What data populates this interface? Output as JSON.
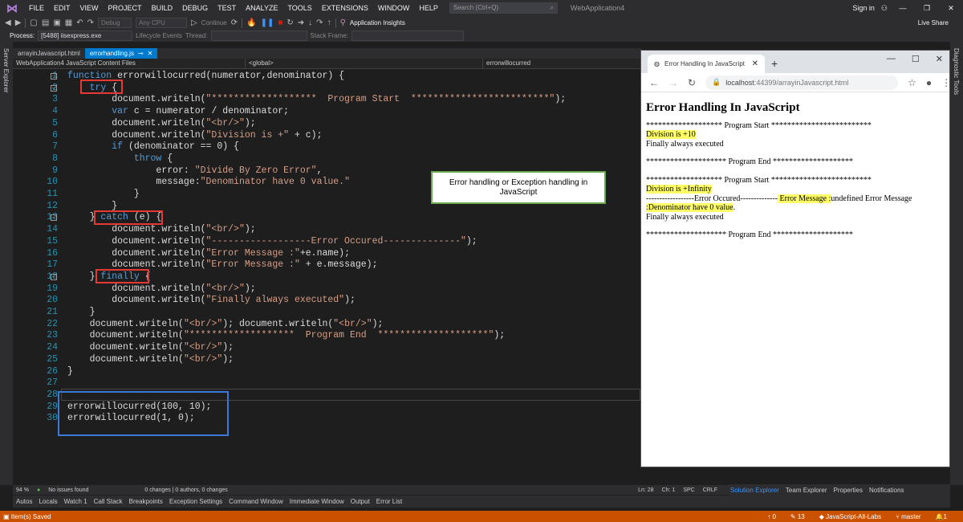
{
  "menubar": {
    "items": [
      "FILE",
      "EDIT",
      "VIEW",
      "PROJECT",
      "BUILD",
      "DEBUG",
      "TEST",
      "ANALYZE",
      "TOOLS",
      "EXTENSIONS",
      "WINDOW",
      "HELP"
    ],
    "search_placeholder": "Search (Ctrl+Q)",
    "solution": "WebApplication4",
    "signin": "Sign in",
    "liveshare": "Live Share"
  },
  "toolbar": {
    "config": "Debug",
    "platform": "Any CPU",
    "continue": "Continue",
    "insights": "Application Insights"
  },
  "procbar": {
    "process_label": "Process:",
    "process_value": "[5488] iisexpress.exe",
    "lifecycle": "Lifecycle Events",
    "thread": "Thread:",
    "stackframe": "Stack Frame:"
  },
  "sidebars": {
    "left": "Server Explorer",
    "right": "Diagnostic Tools"
  },
  "tabs": [
    "arrayinJavascript.html",
    "errorhandling.js"
  ],
  "navbar": {
    "project": "WebApplication4 JavaScript Content Files",
    "scope": "<global>",
    "member": "errorwillocurred"
  },
  "code": {
    "lines": [
      {
        "n": "1",
        "segs": [
          {
            "t": "function ",
            "c": "kw"
          },
          {
            "t": "errorwillocurred(numerator,denominator) {",
            "c": "ident"
          }
        ]
      },
      {
        "n": "2",
        "segs": [
          {
            "t": "    try ",
            "c": "kw"
          },
          {
            "t": "{",
            "c": "ident"
          }
        ]
      },
      {
        "n": "3",
        "segs": [
          {
            "t": "        document.writeln(",
            "c": "ident"
          },
          {
            "t": "\"*******************  Program Start  *************************\"",
            "c": "str"
          },
          {
            "t": ");",
            "c": "ident"
          }
        ]
      },
      {
        "n": "4",
        "segs": [
          {
            "t": "        ",
            "c": "ident"
          },
          {
            "t": "var ",
            "c": "kw"
          },
          {
            "t": "c = numerator / denominator;",
            "c": "ident"
          }
        ]
      },
      {
        "n": "5",
        "segs": [
          {
            "t": "        document.writeln(",
            "c": "ident"
          },
          {
            "t": "\"<br/>\"",
            "c": "str"
          },
          {
            "t": ");",
            "c": "ident"
          }
        ]
      },
      {
        "n": "6",
        "segs": [
          {
            "t": "        document.writeln(",
            "c": "ident"
          },
          {
            "t": "\"Division is +\"",
            "c": "str"
          },
          {
            "t": " + c);",
            "c": "ident"
          }
        ]
      },
      {
        "n": "7",
        "segs": [
          {
            "t": "        ",
            "c": "ident"
          },
          {
            "t": "if ",
            "c": "kw"
          },
          {
            "t": "(denominator == 0) {",
            "c": "ident"
          }
        ]
      },
      {
        "n": "8",
        "segs": [
          {
            "t": "            ",
            "c": "ident"
          },
          {
            "t": "throw ",
            "c": "kw"
          },
          {
            "t": "{",
            "c": "ident"
          }
        ]
      },
      {
        "n": "9",
        "segs": [
          {
            "t": "                error: ",
            "c": "ident"
          },
          {
            "t": "\"Divide By Zero Error\"",
            "c": "str"
          },
          {
            "t": ",",
            "c": "ident"
          }
        ]
      },
      {
        "n": "10",
        "segs": [
          {
            "t": "                message:",
            "c": "ident"
          },
          {
            "t": "\"Denominator have 0 value.\"",
            "c": "str"
          }
        ]
      },
      {
        "n": "11",
        "segs": [
          {
            "t": "            }",
            "c": "ident"
          }
        ]
      },
      {
        "n": "12",
        "segs": [
          {
            "t": "        }",
            "c": "ident"
          }
        ]
      },
      {
        "n": "13",
        "segs": [
          {
            "t": "    } ",
            "c": "ident"
          },
          {
            "t": "catch ",
            "c": "kw"
          },
          {
            "t": "(e) {",
            "c": "ident"
          }
        ]
      },
      {
        "n": "14",
        "segs": [
          {
            "t": "        document.writeln(",
            "c": "ident"
          },
          {
            "t": "\"<br/>\"",
            "c": "str"
          },
          {
            "t": ");",
            "c": "ident"
          }
        ]
      },
      {
        "n": "15",
        "segs": [
          {
            "t": "        document.writeln(",
            "c": "ident"
          },
          {
            "t": "\"------------------Error Occured--------------\"",
            "c": "str"
          },
          {
            "t": ");",
            "c": "ident"
          }
        ]
      },
      {
        "n": "16",
        "segs": [
          {
            "t": "        document.writeln(",
            "c": "ident"
          },
          {
            "t": "\"Error Message :\"",
            "c": "str"
          },
          {
            "t": "+e.name);",
            "c": "ident"
          }
        ]
      },
      {
        "n": "17",
        "segs": [
          {
            "t": "        document.writeln(",
            "c": "ident"
          },
          {
            "t": "\"Error Message :\"",
            "c": "str"
          },
          {
            "t": " + e.message);",
            "c": "ident"
          }
        ]
      },
      {
        "n": "18",
        "segs": [
          {
            "t": "    } ",
            "c": "ident"
          },
          {
            "t": "finally ",
            "c": "kw"
          },
          {
            "t": "{",
            "c": "ident"
          }
        ]
      },
      {
        "n": "19",
        "segs": [
          {
            "t": "        document.writeln(",
            "c": "ident"
          },
          {
            "t": "\"<br/>\"",
            "c": "str"
          },
          {
            "t": ");",
            "c": "ident"
          }
        ]
      },
      {
        "n": "20",
        "segs": [
          {
            "t": "        document.writeln(",
            "c": "ident"
          },
          {
            "t": "\"Finally always executed\"",
            "c": "str"
          },
          {
            "t": ");",
            "c": "ident"
          }
        ]
      },
      {
        "n": "21",
        "segs": [
          {
            "t": "    }",
            "c": "ident"
          }
        ]
      },
      {
        "n": "22",
        "segs": [
          {
            "t": "    document.writeln(",
            "c": "ident"
          },
          {
            "t": "\"<br/>\"",
            "c": "str"
          },
          {
            "t": "); document.writeln(",
            "c": "ident"
          },
          {
            "t": "\"<br/>\"",
            "c": "str"
          },
          {
            "t": ");",
            "c": "ident"
          }
        ]
      },
      {
        "n": "23",
        "segs": [
          {
            "t": "    document.writeln(",
            "c": "ident"
          },
          {
            "t": "\"*******************  Program End  ********************\"",
            "c": "str"
          },
          {
            "t": ");",
            "c": "ident"
          }
        ]
      },
      {
        "n": "24",
        "segs": [
          {
            "t": "    document.writeln(",
            "c": "ident"
          },
          {
            "t": "\"<br/>\"",
            "c": "str"
          },
          {
            "t": ");",
            "c": "ident"
          }
        ]
      },
      {
        "n": "25",
        "segs": [
          {
            "t": "    document.writeln(",
            "c": "ident"
          },
          {
            "t": "\"<br/>\"",
            "c": "str"
          },
          {
            "t": ");",
            "c": "ident"
          }
        ]
      },
      {
        "n": "26",
        "segs": [
          {
            "t": "}",
            "c": "ident"
          }
        ]
      },
      {
        "n": "27",
        "segs": []
      },
      {
        "n": "28",
        "segs": []
      },
      {
        "n": "29",
        "segs": [
          {
            "t": "errorwillocurred(100, 10);",
            "c": "ident"
          }
        ]
      },
      {
        "n": "30",
        "segs": [
          {
            "t": "errorwillocurred(1, 0);",
            "c": "ident"
          }
        ]
      }
    ]
  },
  "annotation": "Error handling or Exception handling in JavaScript",
  "browser": {
    "tab_title": "Error Handling In JavaScript",
    "url_host": "localhost",
    "url_rest": ":44399/arrayinJavascript.html",
    "heading": "Error Handling In JavaScript",
    "start_line": "******************* Program Start *************************",
    "div1": "Division is +10",
    "finally": "Finally always executed",
    "end_line": "******************** Program End ********************",
    "div2": "Division is +Infinity",
    "err_occ": "------------------Error Occured--------------",
    "err_msg_label": " Error Message :",
    "err_msg_val": "undefined Error Message",
    "err_msg2": ":Denominator have 0 value",
    "period": "."
  },
  "status": {
    "zoom": "94 %",
    "issues": "No issues found",
    "changes": "0 changes | 0 authors, 0 changes",
    "ln": "Ln: 28",
    "ch": "Ch: 1",
    "spc": "SPC",
    "crlf": "CRLF"
  },
  "toolwindows": [
    "Autos",
    "Locals",
    "Watch 1",
    "Call Stack",
    "Breakpoints",
    "Exception Settings",
    "Command Window",
    "Immediate Window",
    "Output",
    "Error List"
  ],
  "righttabs": [
    "Solution Explorer",
    "Team Explorer",
    "Properties",
    "Notifications"
  ],
  "statusbar": {
    "saved": "Item(s) Saved",
    "up": "0",
    "pencil": "13",
    "repo": "JavaScript-All-Labs",
    "branch": "master",
    "bell": "1"
  }
}
